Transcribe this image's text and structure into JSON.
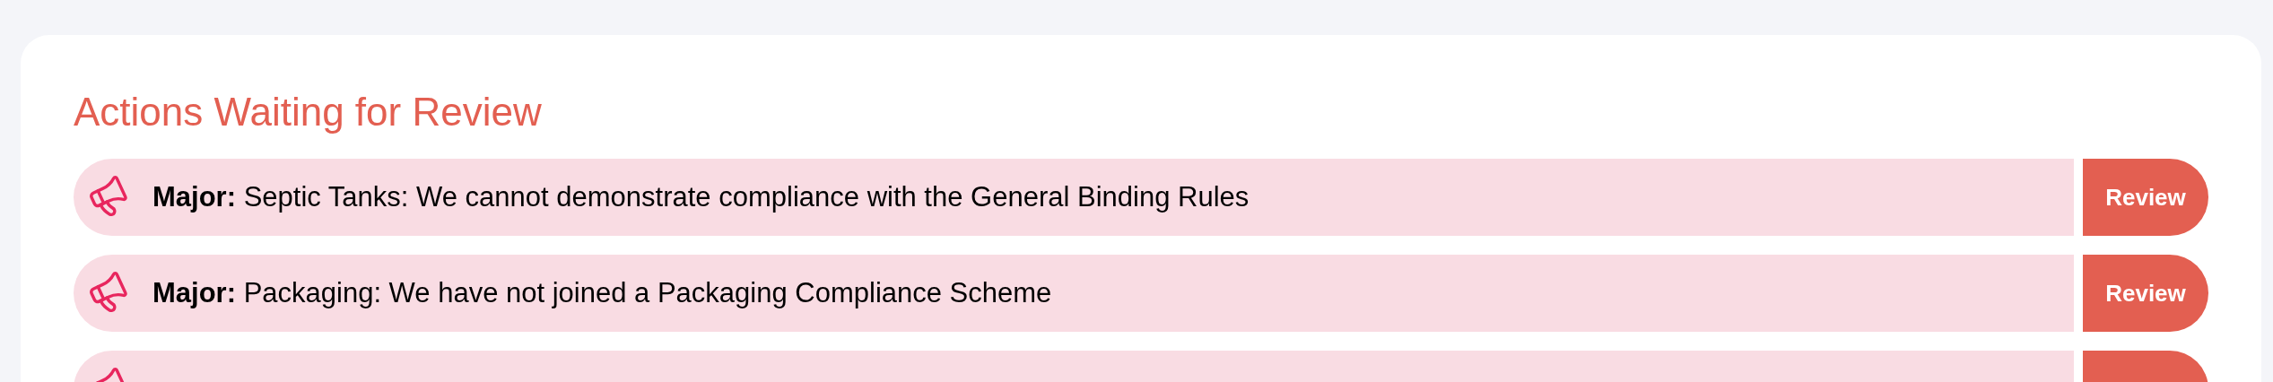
{
  "card": {
    "title": "Actions Waiting for Review",
    "actions": [
      {
        "kind": "full",
        "severity": "Major:",
        "text": "Septic Tanks: We cannot demonstrate compliance with the General Binding Rules",
        "button": "Review"
      },
      {
        "kind": "full",
        "severity": "Major:",
        "text": "Packaging: We have not joined a Packaging Compliance Scheme",
        "button": "Review"
      },
      {
        "kind": "clipped"
      }
    ]
  }
}
